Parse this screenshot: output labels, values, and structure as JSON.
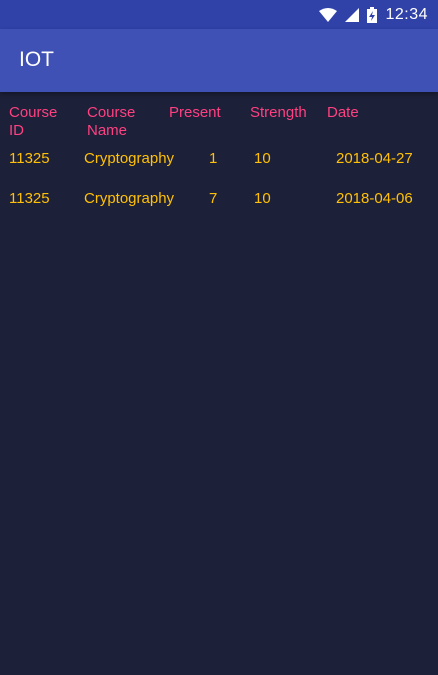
{
  "status_bar": {
    "time": "12:34",
    "icons": [
      "wifi-icon",
      "signal-icon",
      "battery-charging-icon"
    ]
  },
  "app_bar": {
    "title": "IOT"
  },
  "table": {
    "headers": {
      "course_id": [
        "Course",
        "ID"
      ],
      "course_name": [
        "Course",
        "Name"
      ],
      "present": "Present",
      "strength": "Strength",
      "date": "Date"
    },
    "rows": [
      {
        "course_id": "11325",
        "course_name": "Cryptography",
        "present": "1",
        "strength": "10",
        "date": "2018-04-27"
      },
      {
        "course_id": "11325",
        "course_name": "Cryptography",
        "present": "7",
        "strength": "10",
        "date": "2018-04-06"
      }
    ]
  },
  "colors": {
    "background": "#1d2039",
    "status_bar": "#3042a8",
    "app_bar": "#3f51b5",
    "header_text": "#ff4081",
    "row_text": "#ffc107"
  }
}
